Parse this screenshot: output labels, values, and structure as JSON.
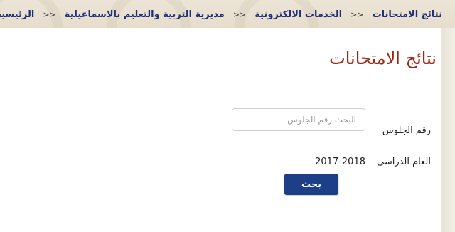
{
  "breadcrumb": {
    "items": [
      "الرئيسية",
      "مديرية التربية والتعليم بالاسماعيلية",
      "الخدمات الالكترونية",
      "نتائج الامتحانات"
    ],
    "separator": ">>"
  },
  "page": {
    "title": "نتائج الامتحانات"
  },
  "form": {
    "seat_label": "رقم الجلوس",
    "seat_placeholder": "البحث رقم الجلوس",
    "seat_value": "",
    "year_label": "العام الدراسى",
    "year_value": "2017-2018",
    "search_button_label": "بحث"
  },
  "colors": {
    "breadcrumb_link": "#1f2f7a",
    "title": "#9b2914",
    "button": "#1d3f88",
    "header_bg": "#ece4d6"
  }
}
